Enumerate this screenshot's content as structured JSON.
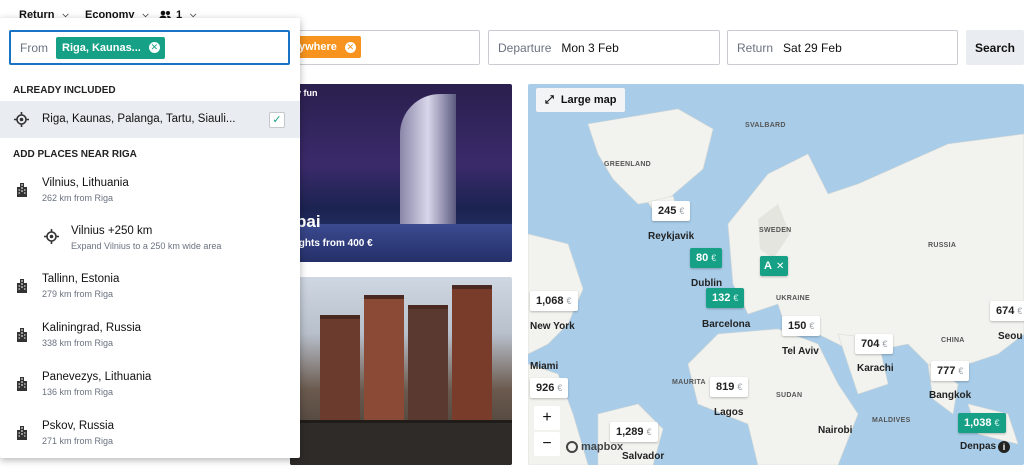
{
  "topbar": {
    "trip_type": "Return",
    "cabin": "Economy",
    "passengers": "1"
  },
  "search": {
    "from_label": "From",
    "from_chip": "Riga, Kaunas...",
    "to_chip": "ywhere",
    "departure_label": "Departure",
    "departure_value": "Mon 3 Feb",
    "return_label": "Return",
    "return_value": "Sat 29 Feb",
    "search_button": "Search"
  },
  "dropdown": {
    "already_included_header": "ALREADY INCLUDED",
    "included_item": "Riga, Kaunas, Palanga, Tartu, Siauli...",
    "add_places_header": "ADD PLACES NEAR RIGA",
    "places": [
      {
        "name": "Vilnius, Lithuania",
        "detail": "262 km from Riga",
        "icon": "city-icon"
      },
      {
        "name": "Vilnius +250 km",
        "detail": "Expand Vilnius to a 250 km wide area",
        "icon": "radius-icon"
      },
      {
        "name": "Tallinn, Estonia",
        "detail": "279 km from Riga",
        "icon": "city-icon"
      },
      {
        "name": "Kaliningrad, Russia",
        "detail": "338 km from Riga",
        "icon": "city-icon"
      },
      {
        "name": "Panevezys, Lithuania",
        "detail": "136 km from Riga",
        "icon": "city-icon"
      },
      {
        "name": "Pskov, Russia",
        "detail": "271 km from Riga",
        "icon": "city-icon"
      }
    ]
  },
  "cards": {
    "card1_tag": "y fun",
    "card1_title": "bai",
    "card1_price": "ights from 400 €"
  },
  "map": {
    "large_map_button": "Large map",
    "attribution": "mapbox",
    "regions": [
      "SVALBARD",
      "GREENLAND",
      "SWEDEN",
      "RUSSIA",
      "UKRAINE",
      "MAURITA",
      "SUDAN",
      "CHINA",
      "MALDIVES"
    ],
    "cities": [
      "Reykjavik",
      "Dublin",
      "Barcelona",
      "Tel Aviv",
      "Karachi",
      "Bangkok",
      "Lagos",
      "Nairobi",
      "New York",
      "Miami",
      "Salvador",
      "Seou",
      "Denpas"
    ],
    "prices": [
      {
        "value": "245",
        "currency": "€",
        "highlight": false
      },
      {
        "value": "80",
        "currency": "€",
        "highlight": true
      },
      {
        "value": "132",
        "currency": "€",
        "highlight": true
      },
      {
        "value": "1,068",
        "currency": "€",
        "highlight": false
      },
      {
        "value": "150",
        "currency": "€",
        "highlight": false
      },
      {
        "value": "704",
        "currency": "€",
        "highlight": false
      },
      {
        "value": "777",
        "currency": "€",
        "highlight": false
      },
      {
        "value": "819",
        "currency": "€",
        "highlight": false
      },
      {
        "value": "926",
        "currency": "€",
        "highlight": false
      },
      {
        "value": "1,289",
        "currency": "€",
        "highlight": false
      },
      {
        "value": "1,038",
        "currency": "€",
        "highlight": true
      },
      {
        "value": "674",
        "currency": "€",
        "highlight": false
      }
    ],
    "origin_marker": "A"
  },
  "colors": {
    "accent_green": "#16a085",
    "accent_orange": "#f7931e",
    "focus_blue": "#1a73c4",
    "map_water": "#a9cde9",
    "map_land": "#f2f3ef"
  }
}
